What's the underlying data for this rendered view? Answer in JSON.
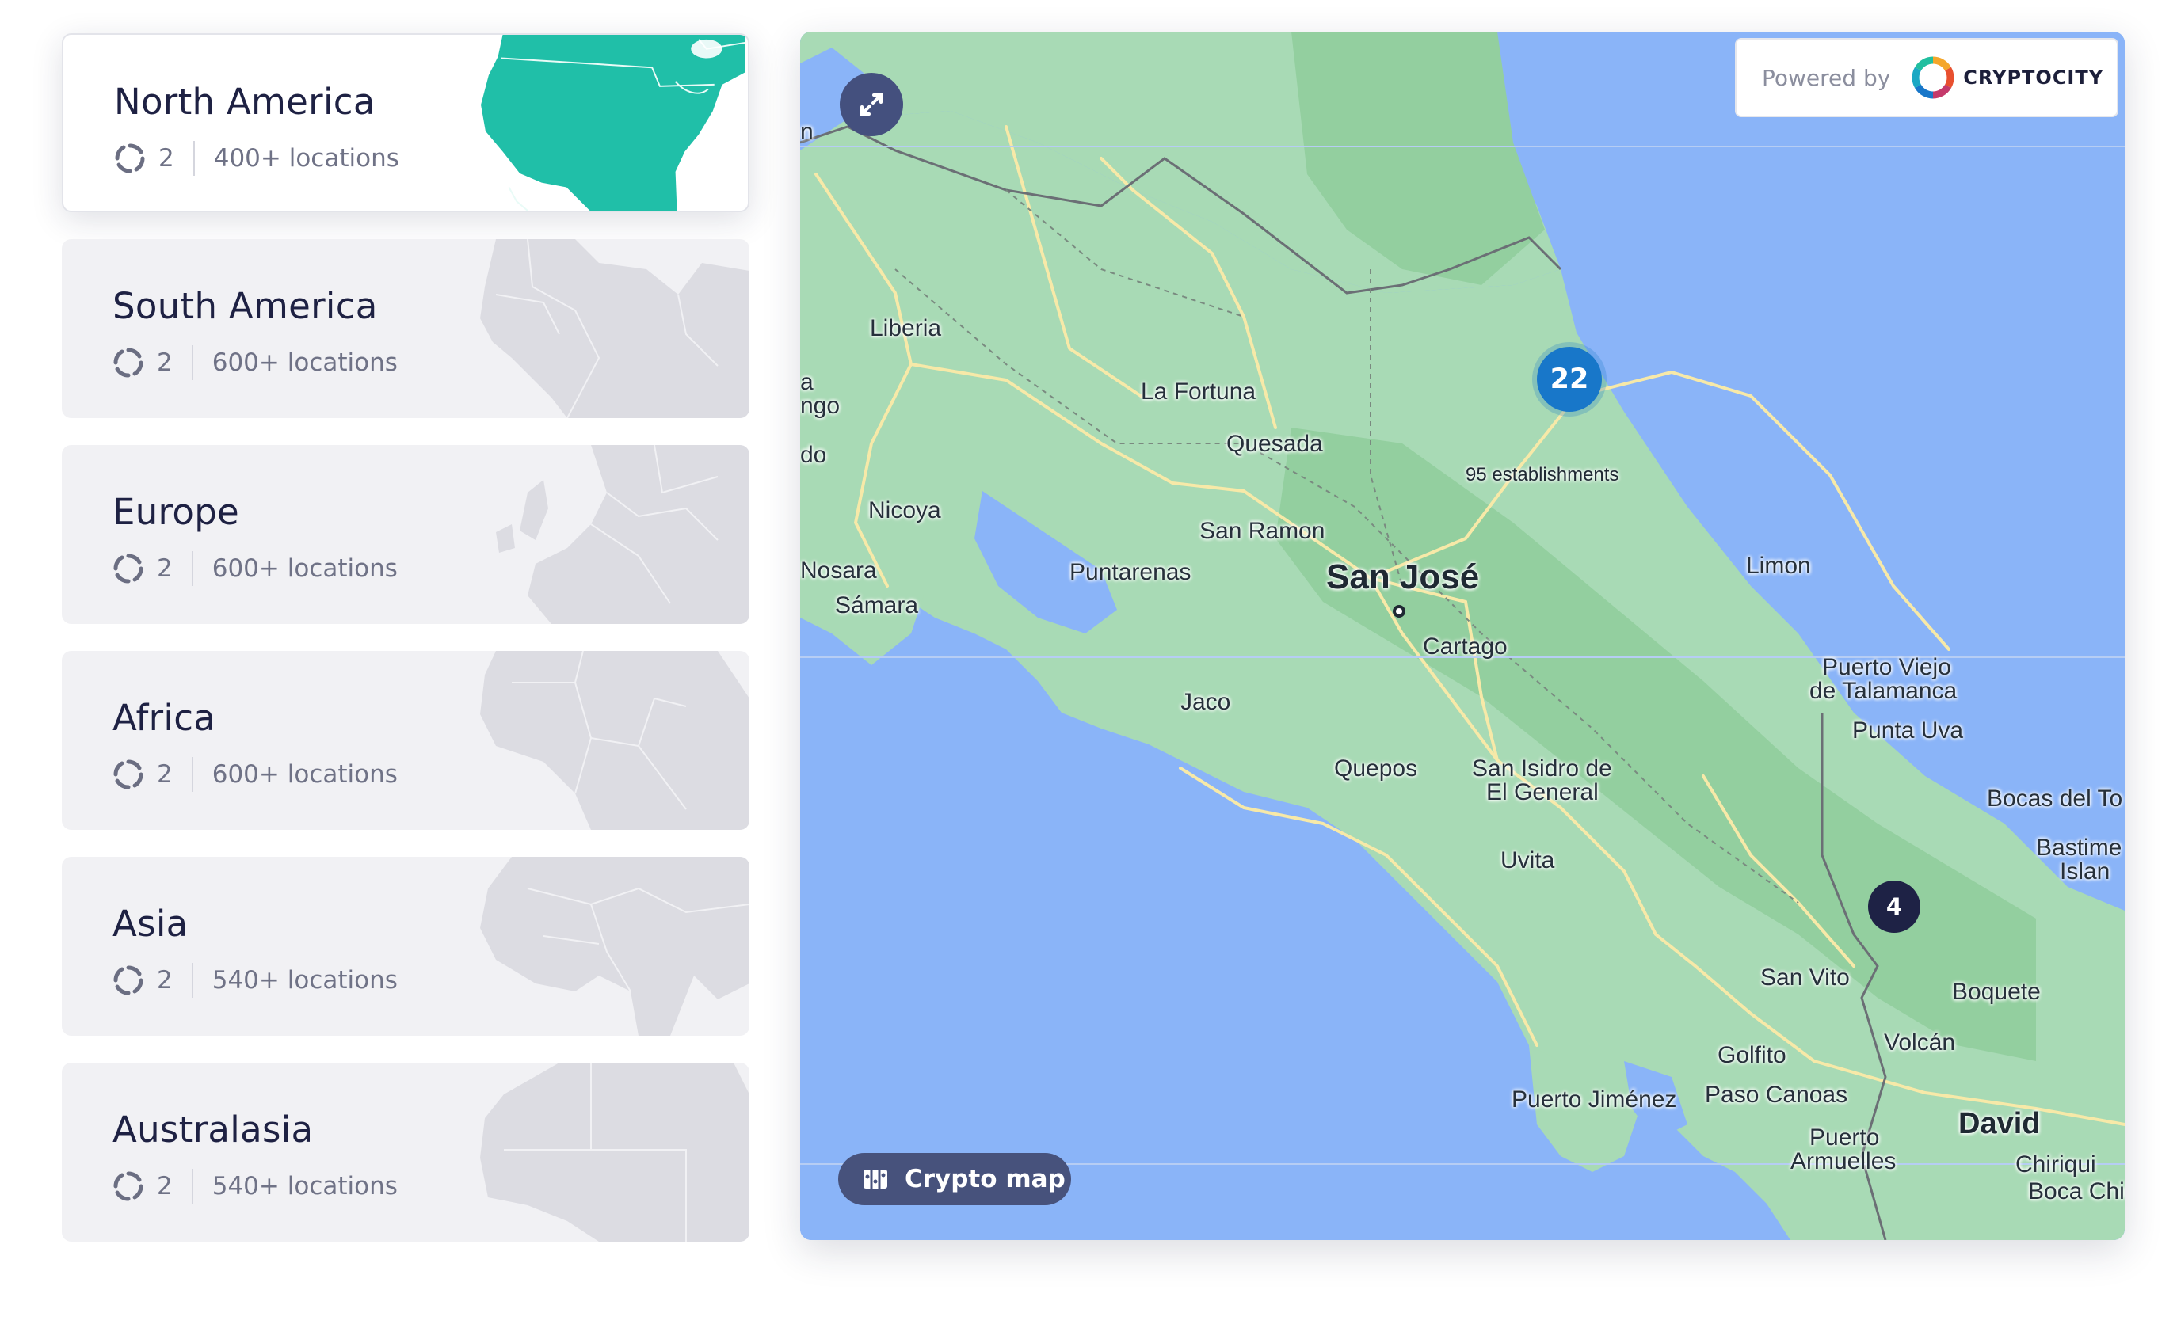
{
  "regions": [
    {
      "name": "North America",
      "count": "2",
      "locations": "400+ locations",
      "active": true
    },
    {
      "name": "South America",
      "count": "2",
      "locations": "600+ locations",
      "active": false
    },
    {
      "name": "Europe",
      "count": "2",
      "locations": "600+ locations",
      "active": false
    },
    {
      "name": "Africa",
      "count": "2",
      "locations": "600+ locations",
      "active": false
    },
    {
      "name": "Asia",
      "count": "2",
      "locations": "540+ locations",
      "active": false
    },
    {
      "name": "Australasia",
      "count": "2",
      "locations": "540+ locations",
      "active": false
    }
  ],
  "map": {
    "powered_by": "Powered by",
    "brand": "CRYPTOCITY",
    "crypto_map_button": "Crypto map",
    "clusters": [
      {
        "count": "22",
        "caption": "95 establishments",
        "color": "#1877c9"
      },
      {
        "count": "4",
        "color": "#1e2245"
      }
    ],
    "places": {
      "san_jose": "San José",
      "liberia": "Liberia",
      "la_fortuna": "La Fortuna",
      "quesada": "Quesada",
      "nicoya": "Nicoya",
      "san_ramon": "San Ramon",
      "puntarenas": "Puntarenas",
      "nosara": "Nosara",
      "samara": "Sámara",
      "cartago": "Cartago",
      "limon": "Limon",
      "puerto_viejo": "Puerto Viejo",
      "de_talamanca": "de Talamanca",
      "punta_uva": "Punta Uva",
      "jaco": "Jaco",
      "quepos": "Quepos",
      "san_isidro": "San Isidro de",
      "el_general": "El General",
      "uvita": "Uvita",
      "bocas": "Bocas del To",
      "bastime": "Bastime",
      "isla": "Islan",
      "san_vito": "San Vito",
      "boquete": "Boquete",
      "volcan": "Volcán",
      "golfito": "Golfito",
      "puerto_jimenez": "Puerto Jiménez",
      "paso_canoas": "Paso Canoas",
      "david": "David",
      "puerto": "Puerto",
      "armuelles": "Armuelles",
      "chiriqui": "Chiriqui",
      "boca_chic": "Boca Chic",
      "edge_a": "a",
      "edge_ngo": "ngo",
      "edge_do": "do",
      "edge_n": "n"
    }
  },
  "colors": {
    "accent": "#20bfa8",
    "land": "#a8dab5",
    "water": "#8ab4f8",
    "cluster_blue": "#1877c9",
    "cluster_dark": "#1e2245"
  }
}
